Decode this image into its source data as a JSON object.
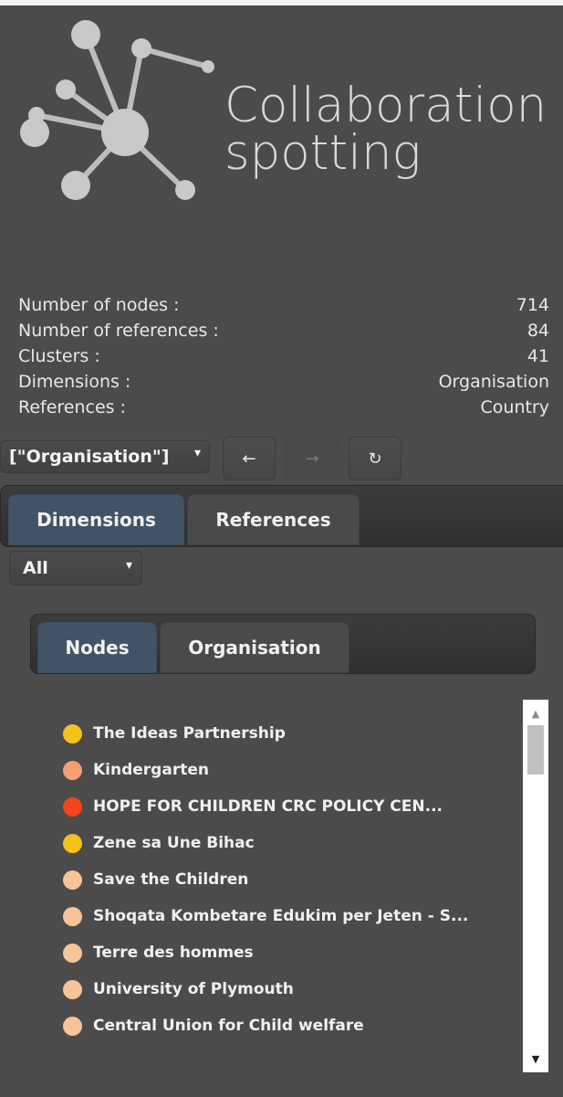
{
  "app": {
    "logo_line1": "Collaboration",
    "logo_line2": "spotting"
  },
  "stats": [
    {
      "label": "Number of nodes :",
      "value": "714"
    },
    {
      "label": "Number of references :",
      "value": "84"
    },
    {
      "label": "Clusters :",
      "value": "41"
    },
    {
      "label": "Dimensions :",
      "value": "Organisation"
    },
    {
      "label": "References :",
      "value": "Country"
    }
  ],
  "controls": {
    "selected_dimension": "[\"Organisation\"]",
    "back_icon": "arrow-left-icon",
    "forward_icon": "arrow-right-icon",
    "refresh_icon": "refresh-icon"
  },
  "main_tabs": {
    "dimensions": "Dimensions",
    "references": "References"
  },
  "filter": {
    "selected": "All"
  },
  "sub_tabs": {
    "nodes": "Nodes",
    "organisation": "Organisation"
  },
  "nodes": [
    {
      "label": "The Ideas Partnership",
      "color": "#f5c21b"
    },
    {
      "label": "Kindergarten",
      "color": "#f4a072"
    },
    {
      "label": "HOPE FOR CHILDREN CRC POLICY CEN...",
      "color": "#f2451c"
    },
    {
      "label": "Zene sa Une Bihac",
      "color": "#f5c21b"
    },
    {
      "label": "Save the Children",
      "color": "#f7c398"
    },
    {
      "label": "Shoqata Kombetare Edukim per Jeten - S...",
      "color": "#f7c398"
    },
    {
      "label": "Terre des hommes",
      "color": "#f7c398"
    },
    {
      "label": "University of Plymouth",
      "color": "#f7c398"
    },
    {
      "label": "Central Union for Child welfare",
      "color": "#f7c398"
    },
    {
      "label": "",
      "color": "#f7c398"
    }
  ],
  "colors": {
    "background": "#4b4b4b",
    "active_tab": "#425366"
  }
}
